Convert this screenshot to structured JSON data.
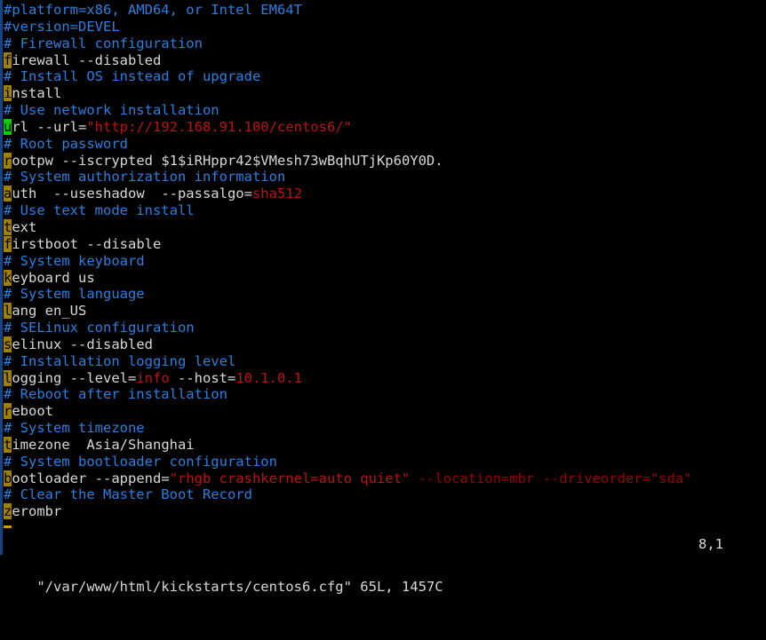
{
  "terminal": {
    "app": "vim",
    "background_color": "#000000",
    "foreground_color": "#d8d8d8",
    "comment_color": "#2a7fe0",
    "keyword_highlight_bg": "#a08000",
    "string_color": "#c01010",
    "dark_string_color": "#9a0000",
    "cursor_color": "#00d000",
    "statusline": {
      "filename": "\"/var/www/html/kickstarts/centos6.cfg\"",
      "file_info": "65L, 1457C",
      "cursor_position": "8,1"
    },
    "lines": [
      {
        "id": "l1",
        "segments": [
          {
            "t": "#platform=x86, AMD64, or Intel EM64T",
            "c": "cmt"
          }
        ]
      },
      {
        "id": "l2",
        "segments": [
          {
            "t": "#version=DEVEL",
            "c": "cmt"
          }
        ]
      },
      {
        "id": "l3",
        "segments": [
          {
            "t": "# Firewall configuration",
            "c": "cmt"
          }
        ]
      },
      {
        "id": "l4",
        "segments": [
          {
            "t": "f",
            "c": "kw"
          },
          {
            "t": "irewall --disabled",
            "c": "plain"
          }
        ]
      },
      {
        "id": "l5",
        "segments": [
          {
            "t": "# Install OS instead of upgrade",
            "c": "cmt"
          }
        ]
      },
      {
        "id": "l6",
        "segments": [
          {
            "t": "i",
            "c": "kw"
          },
          {
            "t": "nstall",
            "c": "plain"
          }
        ]
      },
      {
        "id": "l7",
        "segments": [
          {
            "t": "# Use network installation",
            "c": "cmt"
          }
        ]
      },
      {
        "id": "l8",
        "segments": [
          {
            "t": "u",
            "c": "cursor"
          },
          {
            "t": "rl --url=",
            "c": "plain"
          },
          {
            "t": "\"http://192.168.91.100/centos6/\"",
            "c": "str"
          }
        ]
      },
      {
        "id": "l9",
        "segments": [
          {
            "t": "# Root password",
            "c": "cmt"
          }
        ]
      },
      {
        "id": "l10",
        "segments": [
          {
            "t": "r",
            "c": "kw"
          },
          {
            "t": "ootpw --iscrypted $1$iRHppr42$VMesh73wBqhUTjKp60Y0D.",
            "c": "plain"
          }
        ]
      },
      {
        "id": "l11",
        "segments": [
          {
            "t": "# System authorization information",
            "c": "cmt"
          }
        ]
      },
      {
        "id": "l12",
        "segments": [
          {
            "t": "a",
            "c": "kw"
          },
          {
            "t": "uth  --useshadow  --passalgo=",
            "c": "plain"
          },
          {
            "t": "sha512",
            "c": "str"
          }
        ]
      },
      {
        "id": "l13",
        "segments": [
          {
            "t": "# Use text mode install",
            "c": "cmt"
          }
        ]
      },
      {
        "id": "l14",
        "segments": [
          {
            "t": "t",
            "c": "kw"
          },
          {
            "t": "ext",
            "c": "plain"
          }
        ]
      },
      {
        "id": "l15",
        "segments": [
          {
            "t": "f",
            "c": "kw"
          },
          {
            "t": "irstboot --disable",
            "c": "plain"
          }
        ]
      },
      {
        "id": "l16",
        "segments": [
          {
            "t": "# System keyboard",
            "c": "cmt"
          }
        ]
      },
      {
        "id": "l17",
        "segments": [
          {
            "t": "k",
            "c": "kw"
          },
          {
            "t": "eyboard us",
            "c": "plain"
          }
        ]
      },
      {
        "id": "l18",
        "segments": [
          {
            "t": "# System language",
            "c": "cmt"
          }
        ]
      },
      {
        "id": "l19",
        "segments": [
          {
            "t": "l",
            "c": "kw"
          },
          {
            "t": "ang en_US",
            "c": "plain"
          }
        ]
      },
      {
        "id": "l20",
        "segments": [
          {
            "t": "# SELinux configuration",
            "c": "cmt"
          }
        ]
      },
      {
        "id": "l21",
        "segments": [
          {
            "t": "s",
            "c": "kw"
          },
          {
            "t": "elinux --disabled",
            "c": "plain"
          }
        ]
      },
      {
        "id": "l22",
        "segments": [
          {
            "t": "# Installation logging level",
            "c": "cmt"
          }
        ]
      },
      {
        "id": "l23",
        "segments": [
          {
            "t": "l",
            "c": "kw"
          },
          {
            "t": "ogging --level=",
            "c": "plain"
          },
          {
            "t": "info",
            "c": "str"
          },
          {
            "t": " --host=",
            "c": "plain"
          },
          {
            "t": "10.1.0.1",
            "c": "str"
          }
        ]
      },
      {
        "id": "l24",
        "segments": [
          {
            "t": "# Reboot after installation",
            "c": "cmt"
          }
        ]
      },
      {
        "id": "l25",
        "segments": [
          {
            "t": "r",
            "c": "kw"
          },
          {
            "t": "eboot",
            "c": "plain"
          }
        ]
      },
      {
        "id": "l26",
        "segments": [
          {
            "t": "# System timezone",
            "c": "cmt"
          }
        ]
      },
      {
        "id": "l27",
        "segments": [
          {
            "t": "t",
            "c": "kw"
          },
          {
            "t": "imezone  Asia/Shanghai",
            "c": "plain"
          }
        ]
      },
      {
        "id": "l28",
        "segments": [
          {
            "t": "# System bootloader configuration",
            "c": "cmt"
          }
        ]
      },
      {
        "id": "l29",
        "segments": [
          {
            "t": "b",
            "c": "kw"
          },
          {
            "t": "ootloader --append=",
            "c": "plain"
          },
          {
            "t": "\"rhgb crashkernel=auto quiet\"",
            "c": "str"
          },
          {
            "t": " --location=mbr --driveorder=\"sda\"",
            "c": "dkred"
          }
        ]
      },
      {
        "id": "l30",
        "segments": [
          {
            "t": "# Clear the Master Boot Record",
            "c": "cmt"
          }
        ]
      },
      {
        "id": "l31",
        "segments": [
          {
            "t": "z",
            "c": "kw"
          },
          {
            "t": "erombr",
            "c": "plain"
          }
        ]
      }
    ]
  }
}
